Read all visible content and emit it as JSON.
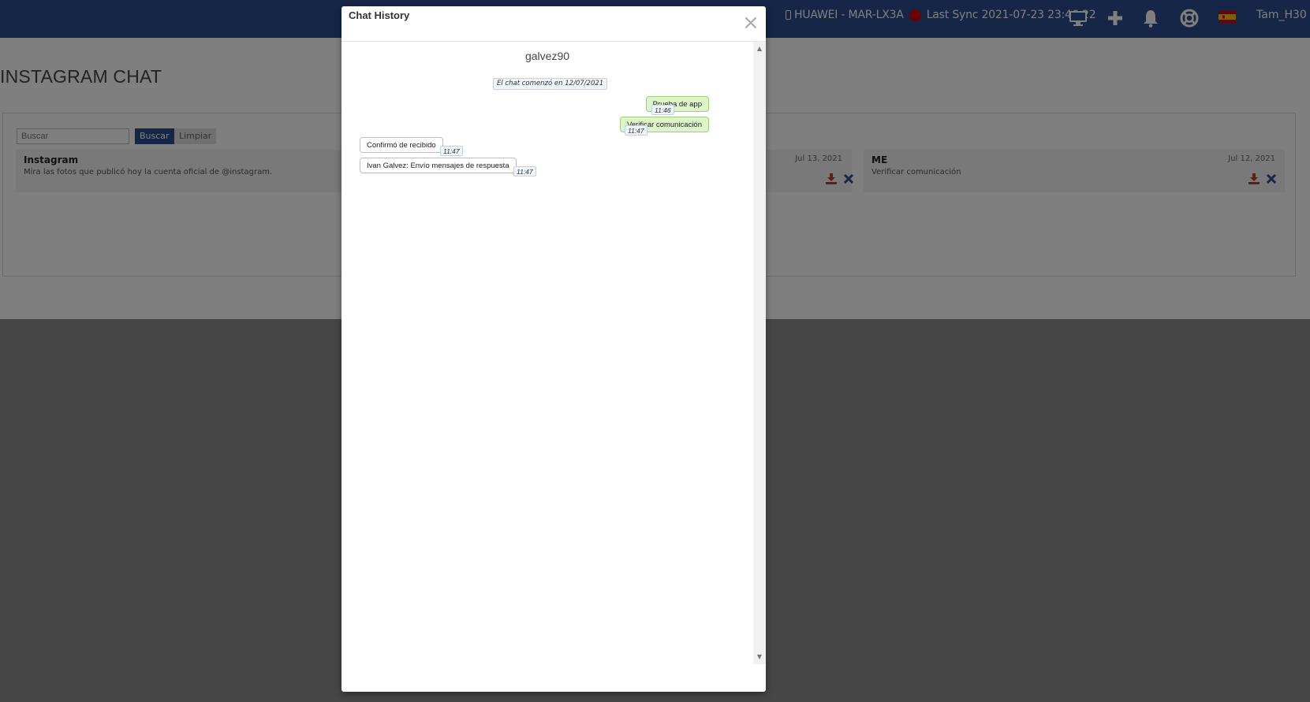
{
  "topbar": {
    "device": "HUAWEI - MAR-LX3A",
    "last_sync": "Last Sync 2021-07-23 23:46:22",
    "user": "Tam_H30",
    "icons": [
      "monitor-icon",
      "plus-icon",
      "bell-icon",
      "lifebuoy-icon",
      "spain-flag-icon"
    ]
  },
  "page": {
    "title": "INSTAGRAM CHAT"
  },
  "search": {
    "placeholder": "Buscar",
    "search_label": "Buscar",
    "clear_label": "Limpiar"
  },
  "chats": [
    {
      "name": "Instagram",
      "preview": "Mira las fotos que publicó hoy la cuenta oficial de @instagram.",
      "date": "Jul 13, 2021"
    },
    {
      "name": "ME",
      "preview": "Verificar comunicación",
      "date": "Jul 12, 2021"
    }
  ],
  "modal": {
    "title": "Chat History",
    "close": "×",
    "contact": "galvez90",
    "chat_start": "El chat comenzó en 12/07/2021",
    "messages": [
      {
        "direction": "out",
        "text": "Prueba de app",
        "time": "11:46"
      },
      {
        "direction": "out",
        "text": "Verificar comunicación",
        "time": "11:47"
      },
      {
        "direction": "in",
        "text": "Confirmó de recibido",
        "time": "11:47"
      },
      {
        "direction": "in",
        "text": "Ivan Galvez: Envío mensajes de respuesta",
        "time": "11:47"
      }
    ]
  },
  "colors": {
    "topbar": "#2b4c8f",
    "outgoing_bubble": "#ddf5c9",
    "incoming_bubble": "#ffffff",
    "sync_status": "#d80000",
    "download_icon": "#c0392b",
    "delete_icon": "#2b4c8f"
  }
}
